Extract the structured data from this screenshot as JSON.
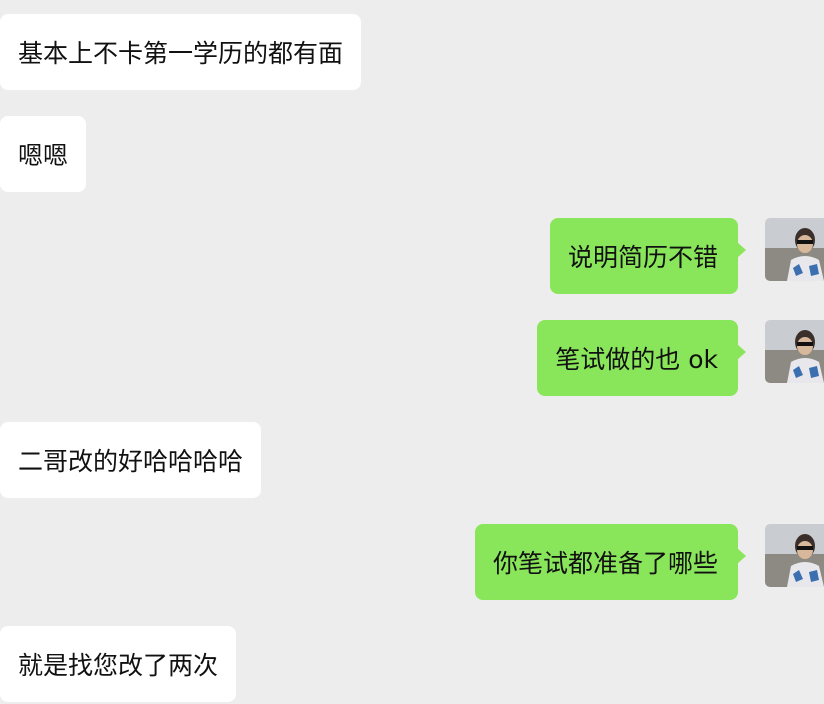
{
  "colors": {
    "background": "#ededed",
    "incoming_bubble": "#ffffff",
    "outgoing_bubble": "#89e65a"
  },
  "messages": [
    {
      "side": "left",
      "text": "基本上不卡第一学历的都有面"
    },
    {
      "side": "left",
      "text": "嗯嗯"
    },
    {
      "side": "right",
      "text": "说明简历不错",
      "avatar": "user-avatar"
    },
    {
      "side": "right",
      "text": "笔试做的也 ok",
      "avatar": "user-avatar"
    },
    {
      "side": "left",
      "text": "二哥改的好哈哈哈哈"
    },
    {
      "side": "right",
      "text": "你笔试都准备了哪些",
      "avatar": "user-avatar"
    },
    {
      "side": "left",
      "text": "就是找您改了两次"
    }
  ]
}
